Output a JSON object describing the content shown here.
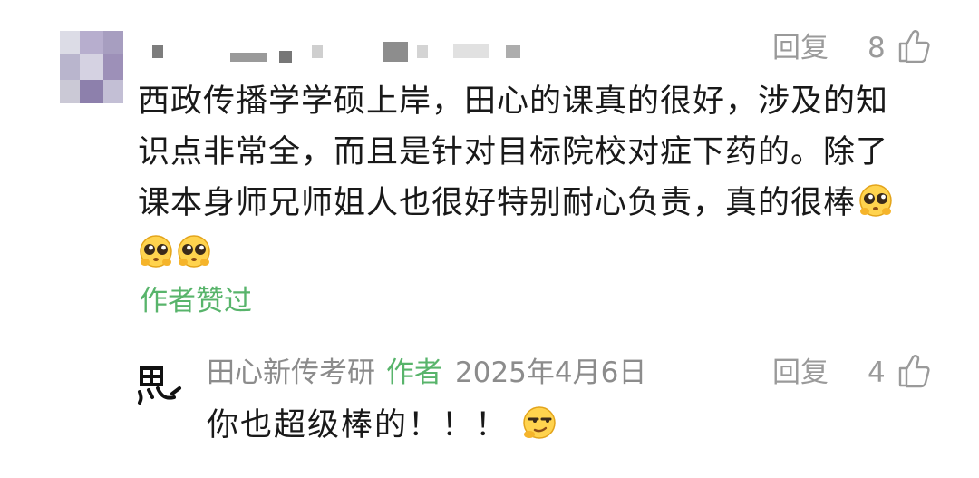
{
  "comment": {
    "avatar_icon": "blurred-avatar",
    "username_redacted": true,
    "reply_label": "回复",
    "like_count": "8",
    "like_icon": "thumbs-up-icon",
    "text_lines": [
      "西政传播学学硕上岸，田心的课真的很好，涉及的知",
      "识点非常全，而且是针对目标院校对症下药的。除了",
      "课本身师兄师姐人也很好特别耐心负责，真的很棒"
    ],
    "emoji_name": "pleading-face-emoji",
    "author_liked": "作者赞过"
  },
  "reply": {
    "avatar_icon": "calligraphy-avatar",
    "author_name": "田心新传考研",
    "author_tag": "作者",
    "date": "2025年4月6日",
    "reply_label": "回复",
    "like_count": "4",
    "like_icon": "thumbs-up-icon",
    "text": "你也超级棒的！！！",
    "emoji_name": "smirk-face-emoji"
  },
  "colors": {
    "text": "#191919",
    "meta": "#9a9a9a",
    "author_green": "#58b46b"
  }
}
